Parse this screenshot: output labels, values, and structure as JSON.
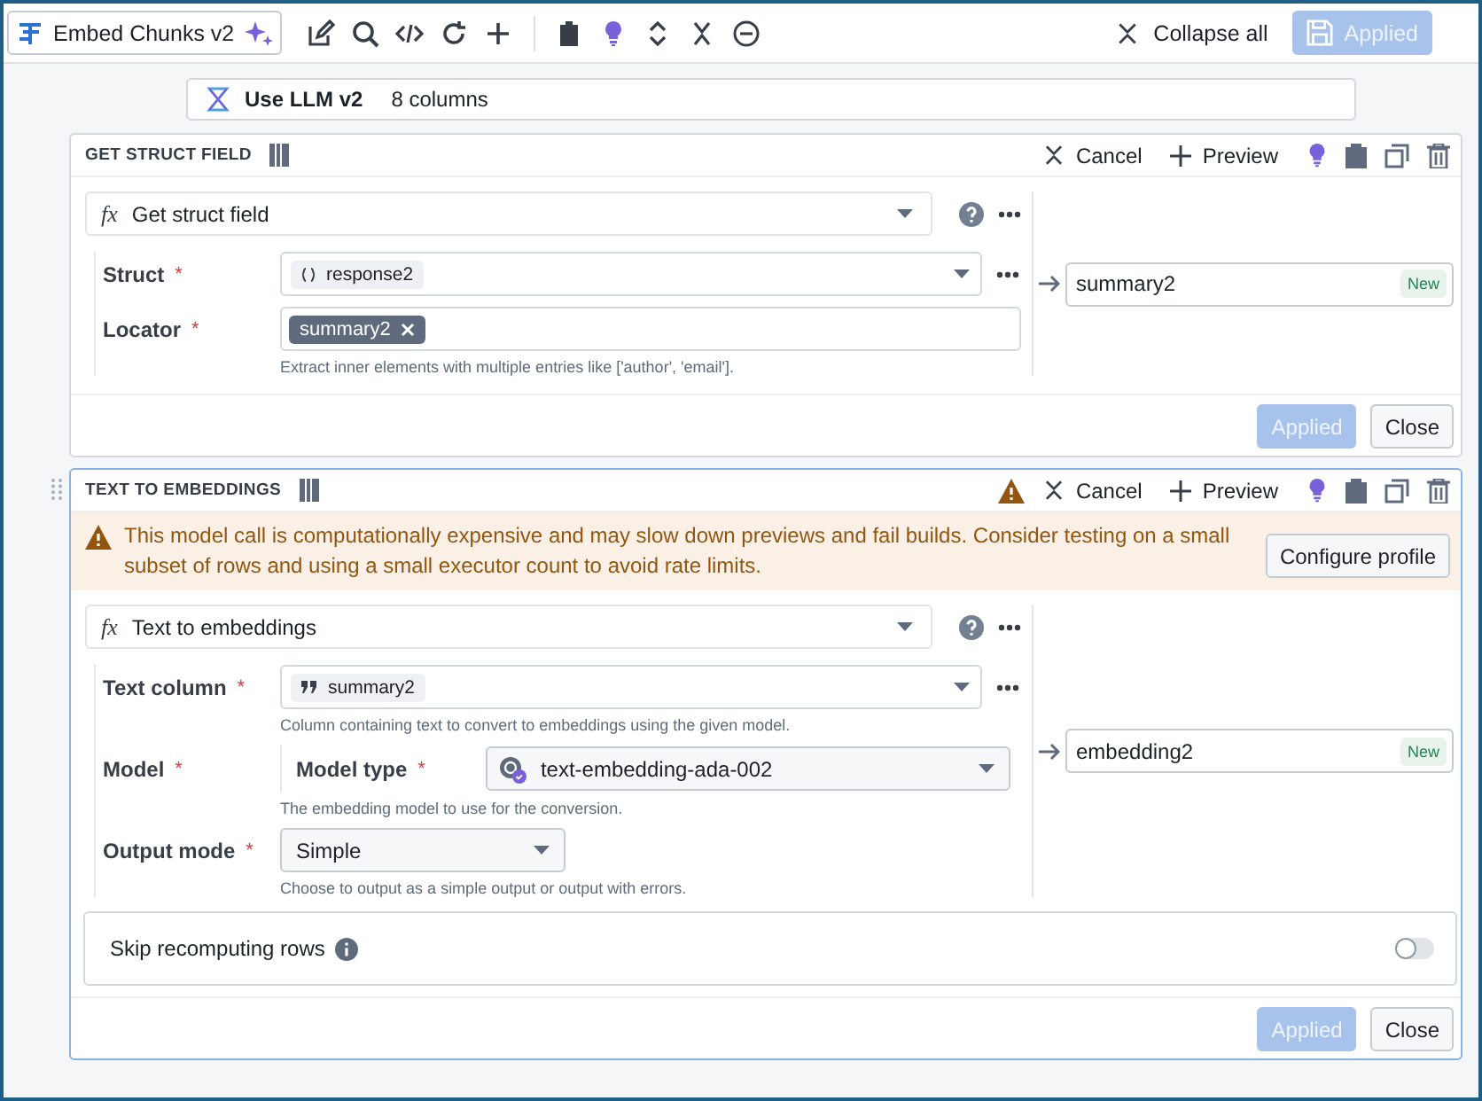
{
  "toolbar": {
    "pipeline_name": "Embed Chunks v2",
    "collapse_all": "Collapse all",
    "save_button": {
      "label": "Applied",
      "disabled": true
    }
  },
  "input_node": {
    "name": "Use LLM v2",
    "columns": "8 columns"
  },
  "cards": [
    {
      "title": "GET STRUCT FIELD",
      "selected": false,
      "cancel": "Cancel",
      "preview": "Preview",
      "function_symbol": "fx",
      "function": "Get struct field",
      "params": [
        {
          "kind": "struct_column",
          "label": "Struct",
          "required_mark": "*",
          "value": "response2"
        },
        {
          "kind": "tags",
          "label": "Locator",
          "required_mark": "*",
          "tags": [
            "summary2"
          ],
          "hint": "Extract inner elements with multiple entries like ['author', 'email']."
        }
      ],
      "output": {
        "name": "summary2",
        "badge": "New"
      },
      "apply": {
        "label": "Applied",
        "disabled": true
      },
      "close": "Close"
    },
    {
      "title": "TEXT TO EMBEDDINGS",
      "selected": true,
      "cancel": "Cancel",
      "preview": "Preview",
      "warning": {
        "text": "This model call is computationally expensive and may slow down previews and fail builds. Consider testing on a small subset of rows and using a small executor count to avoid rate limits.",
        "button": "Configure profile"
      },
      "function_symbol": "fx",
      "function": "Text to embeddings",
      "params": [
        {
          "kind": "string_column",
          "label": "Text column",
          "required_mark": "*",
          "value": "summary2",
          "hint": "Column containing text to convert to embeddings using the given model."
        },
        {
          "kind": "model",
          "label": "Model",
          "required_mark": "*",
          "sub_label": "Model type",
          "sub_required_mark": "*",
          "value": "text-embedding-ada-002",
          "hint": "The embedding model to use for the conversion."
        },
        {
          "kind": "dropdown",
          "label": "Output mode",
          "required_mark": "*",
          "value": "Simple",
          "hint": "Choose to output as a simple output or output with errors."
        }
      ],
      "output": {
        "name": "embedding2",
        "badge": "New"
      },
      "skip": {
        "label": "Skip recomputing rows",
        "on": false
      },
      "apply": {
        "label": "Applied",
        "disabled": true
      },
      "close": "Close"
    }
  ]
}
